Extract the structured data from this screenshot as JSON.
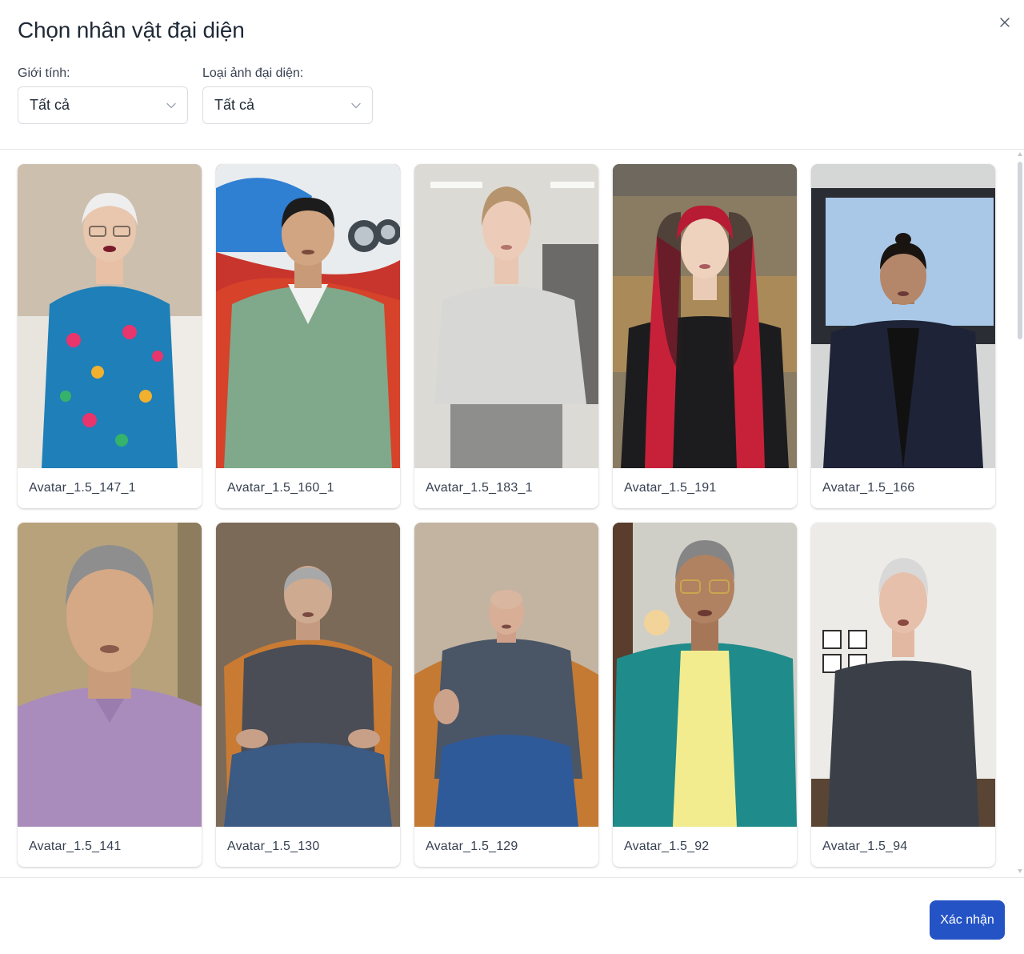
{
  "dialog": {
    "title": "Chọn nhân vật đại diện",
    "close_icon": "close-icon"
  },
  "filters": {
    "gender": {
      "label": "Giới tính:",
      "value": "Tất cả"
    },
    "avatar_type": {
      "label": "Loại ảnh đại diện:",
      "value": "Tất cả"
    }
  },
  "avatars": [
    {
      "name": "Avatar_1.5_147_1"
    },
    {
      "name": "Avatar_1.5_160_1"
    },
    {
      "name": "Avatar_1.5_183_1"
    },
    {
      "name": "Avatar_1.5_191"
    },
    {
      "name": "Avatar_1.5_166"
    },
    {
      "name": "Avatar_1.5_141"
    },
    {
      "name": "Avatar_1.5_130"
    },
    {
      "name": "Avatar_1.5_129"
    },
    {
      "name": "Avatar_1.5_92"
    },
    {
      "name": "Avatar_1.5_94"
    }
  ],
  "footer": {
    "confirm_label": "Xác nhận"
  },
  "colors": {
    "primary": "#2453c6",
    "border": "#e5e7eb",
    "text": "#1f2937"
  }
}
